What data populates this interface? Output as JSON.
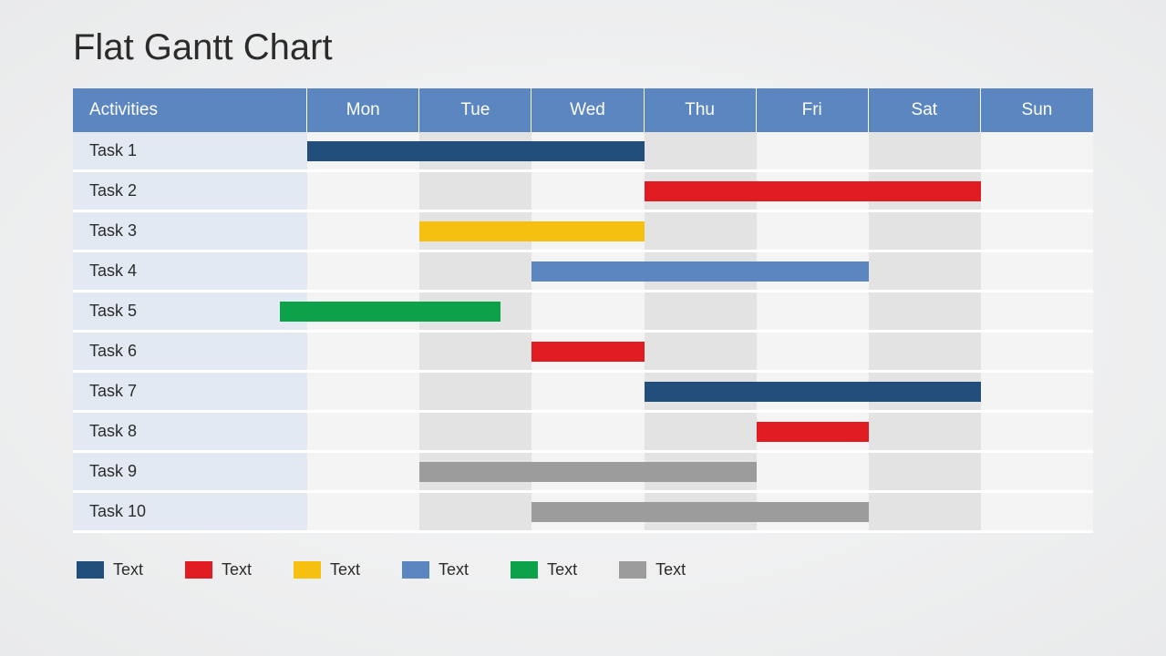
{
  "title": "Flat Gantt Chart",
  "header": {
    "activities": "Activities",
    "days": [
      "Mon",
      "Tue",
      "Wed",
      "Thu",
      "Fri",
      "Sat",
      "Sun"
    ]
  },
  "rows": [
    {
      "label": "Task 1"
    },
    {
      "label": "Task 2"
    },
    {
      "label": "Task 3"
    },
    {
      "label": "Task 4"
    },
    {
      "label": "Task 5"
    },
    {
      "label": "Task 6"
    },
    {
      "label": "Task 7"
    },
    {
      "label": "Task 8"
    },
    {
      "label": "Task 9"
    },
    {
      "label": "Task 10"
    }
  ],
  "legend": [
    {
      "color": "navy",
      "label": "Text"
    },
    {
      "color": "red",
      "label": "Text"
    },
    {
      "color": "yellow",
      "label": "Text"
    },
    {
      "color": "blue",
      "label": "Text"
    },
    {
      "color": "green",
      "label": "Text"
    },
    {
      "color": "grey",
      "label": "Text"
    }
  ],
  "chart_data": {
    "type": "gantt",
    "title": "Flat Gantt Chart",
    "categories": [
      "Mon",
      "Tue",
      "Wed",
      "Thu",
      "Fri",
      "Sat",
      "Sun"
    ],
    "tasks": [
      {
        "name": "Task 1",
        "start": 0.0,
        "end": 3.0,
        "color": "navy"
      },
      {
        "name": "Task 2",
        "start": 3.0,
        "end": 6.0,
        "color": "red"
      },
      {
        "name": "Task 3",
        "start": 1.0,
        "end": 3.0,
        "color": "yellow"
      },
      {
        "name": "Task 4",
        "start": 2.0,
        "end": 5.0,
        "color": "blue"
      },
      {
        "name": "Task 5",
        "start": -0.25,
        "end": 1.75,
        "color": "green"
      },
      {
        "name": "Task 6",
        "start": 2.0,
        "end": 3.0,
        "color": "red"
      },
      {
        "name": "Task 7",
        "start": 3.0,
        "end": 6.0,
        "color": "navy"
      },
      {
        "name": "Task 8",
        "start": 4.0,
        "end": 5.0,
        "color": "red"
      },
      {
        "name": "Task 9",
        "start": 1.0,
        "end": 4.0,
        "color": "grey"
      },
      {
        "name": "Task 10",
        "start": 2.0,
        "end": 5.0,
        "color": "grey"
      }
    ],
    "legend": [
      {
        "color": "navy",
        "label": "Text"
      },
      {
        "color": "red",
        "label": "Text"
      },
      {
        "color": "yellow",
        "label": "Text"
      },
      {
        "color": "blue",
        "label": "Text"
      },
      {
        "color": "green",
        "label": "Text"
      },
      {
        "color": "grey",
        "label": "Text"
      }
    ]
  }
}
